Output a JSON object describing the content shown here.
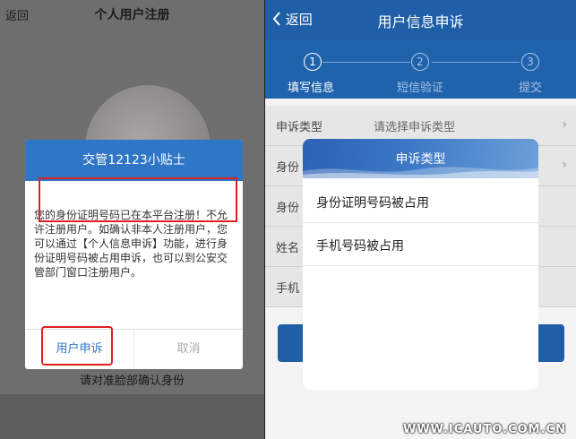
{
  "left": {
    "back_label": "返回",
    "title": "个人用户注册",
    "dialog": {
      "title": "交管12123小贴士",
      "message": "您的身份证明号码已在本平台注册！不允许注册用户。如确认非本人注册用户，您可以通过【个人信息申诉】功能，进行身份证明号码被占用申诉，也可以到公安交管部门窗口注册用户。",
      "appeal_button": "用户申诉",
      "cancel_button": "取消"
    },
    "caption": "请对准脸部确认身份"
  },
  "right": {
    "back_label": "返回",
    "title": "用户信息申诉",
    "steps": [
      {
        "number": "1",
        "label": "填写信息",
        "active": true
      },
      {
        "number": "2",
        "label": "短信验证",
        "active": false
      },
      {
        "number": "3",
        "label": "提交",
        "active": false
      }
    ],
    "form": {
      "rows": [
        {
          "label": "申诉类型",
          "value": "请选择申诉类型"
        },
        {
          "label": "身份",
          "value": ""
        },
        {
          "label": "身份",
          "value": ""
        },
        {
          "label": "姓名",
          "value": ""
        },
        {
          "label": "手机",
          "value": ""
        }
      ]
    },
    "modal": {
      "title": "申诉类型",
      "options": [
        "身份证明号码被占用",
        "手机号码被占用"
      ]
    }
  },
  "watermark": "WWW.ICAUTO.COM.CN",
  "colors": {
    "primary": "#2f76c6",
    "header_dark": "#1f5fa8",
    "highlight": "#e02020"
  }
}
